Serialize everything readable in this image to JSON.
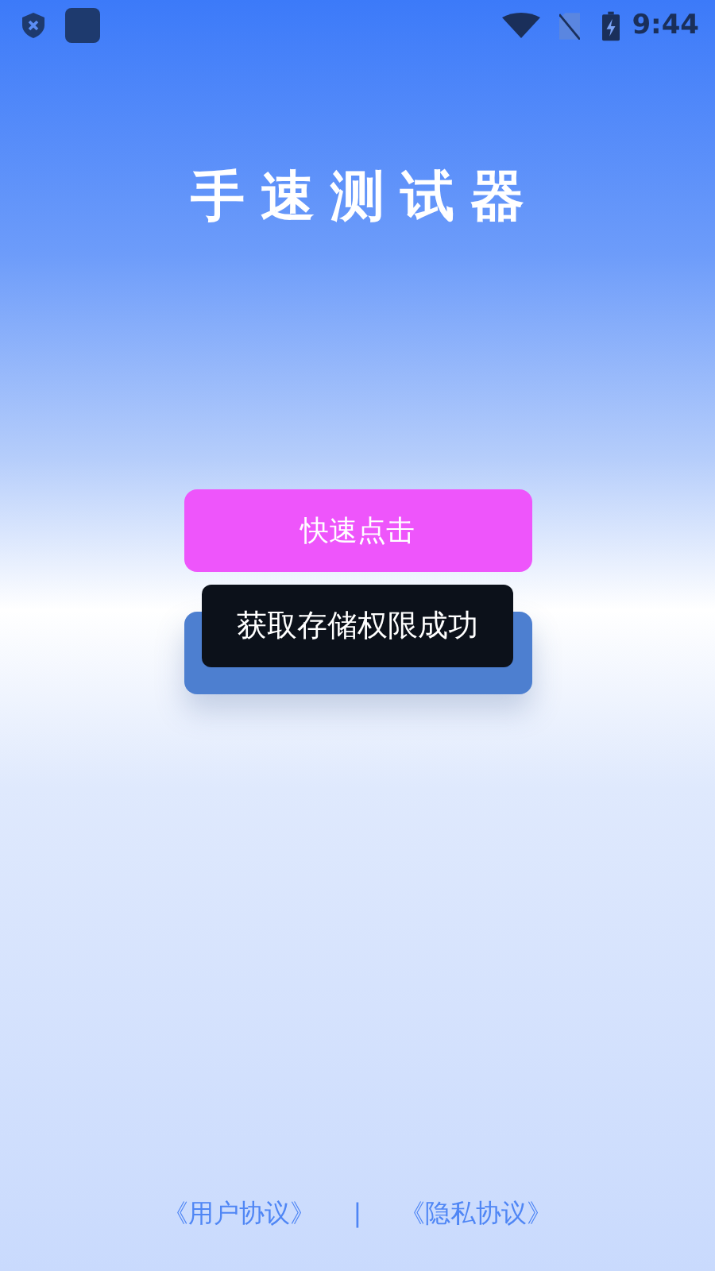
{
  "status_bar": {
    "time": "9:44"
  },
  "title": "手速测试器",
  "buttons": [
    {
      "label": "快速点击",
      "kind": "tap"
    },
    {
      "kind": "swipe"
    }
  ],
  "toast": "获取存储权限成功",
  "footer": {
    "links": [
      "《用户协议》",
      "《隐私协议》"
    ],
    "separator": "|"
  }
}
